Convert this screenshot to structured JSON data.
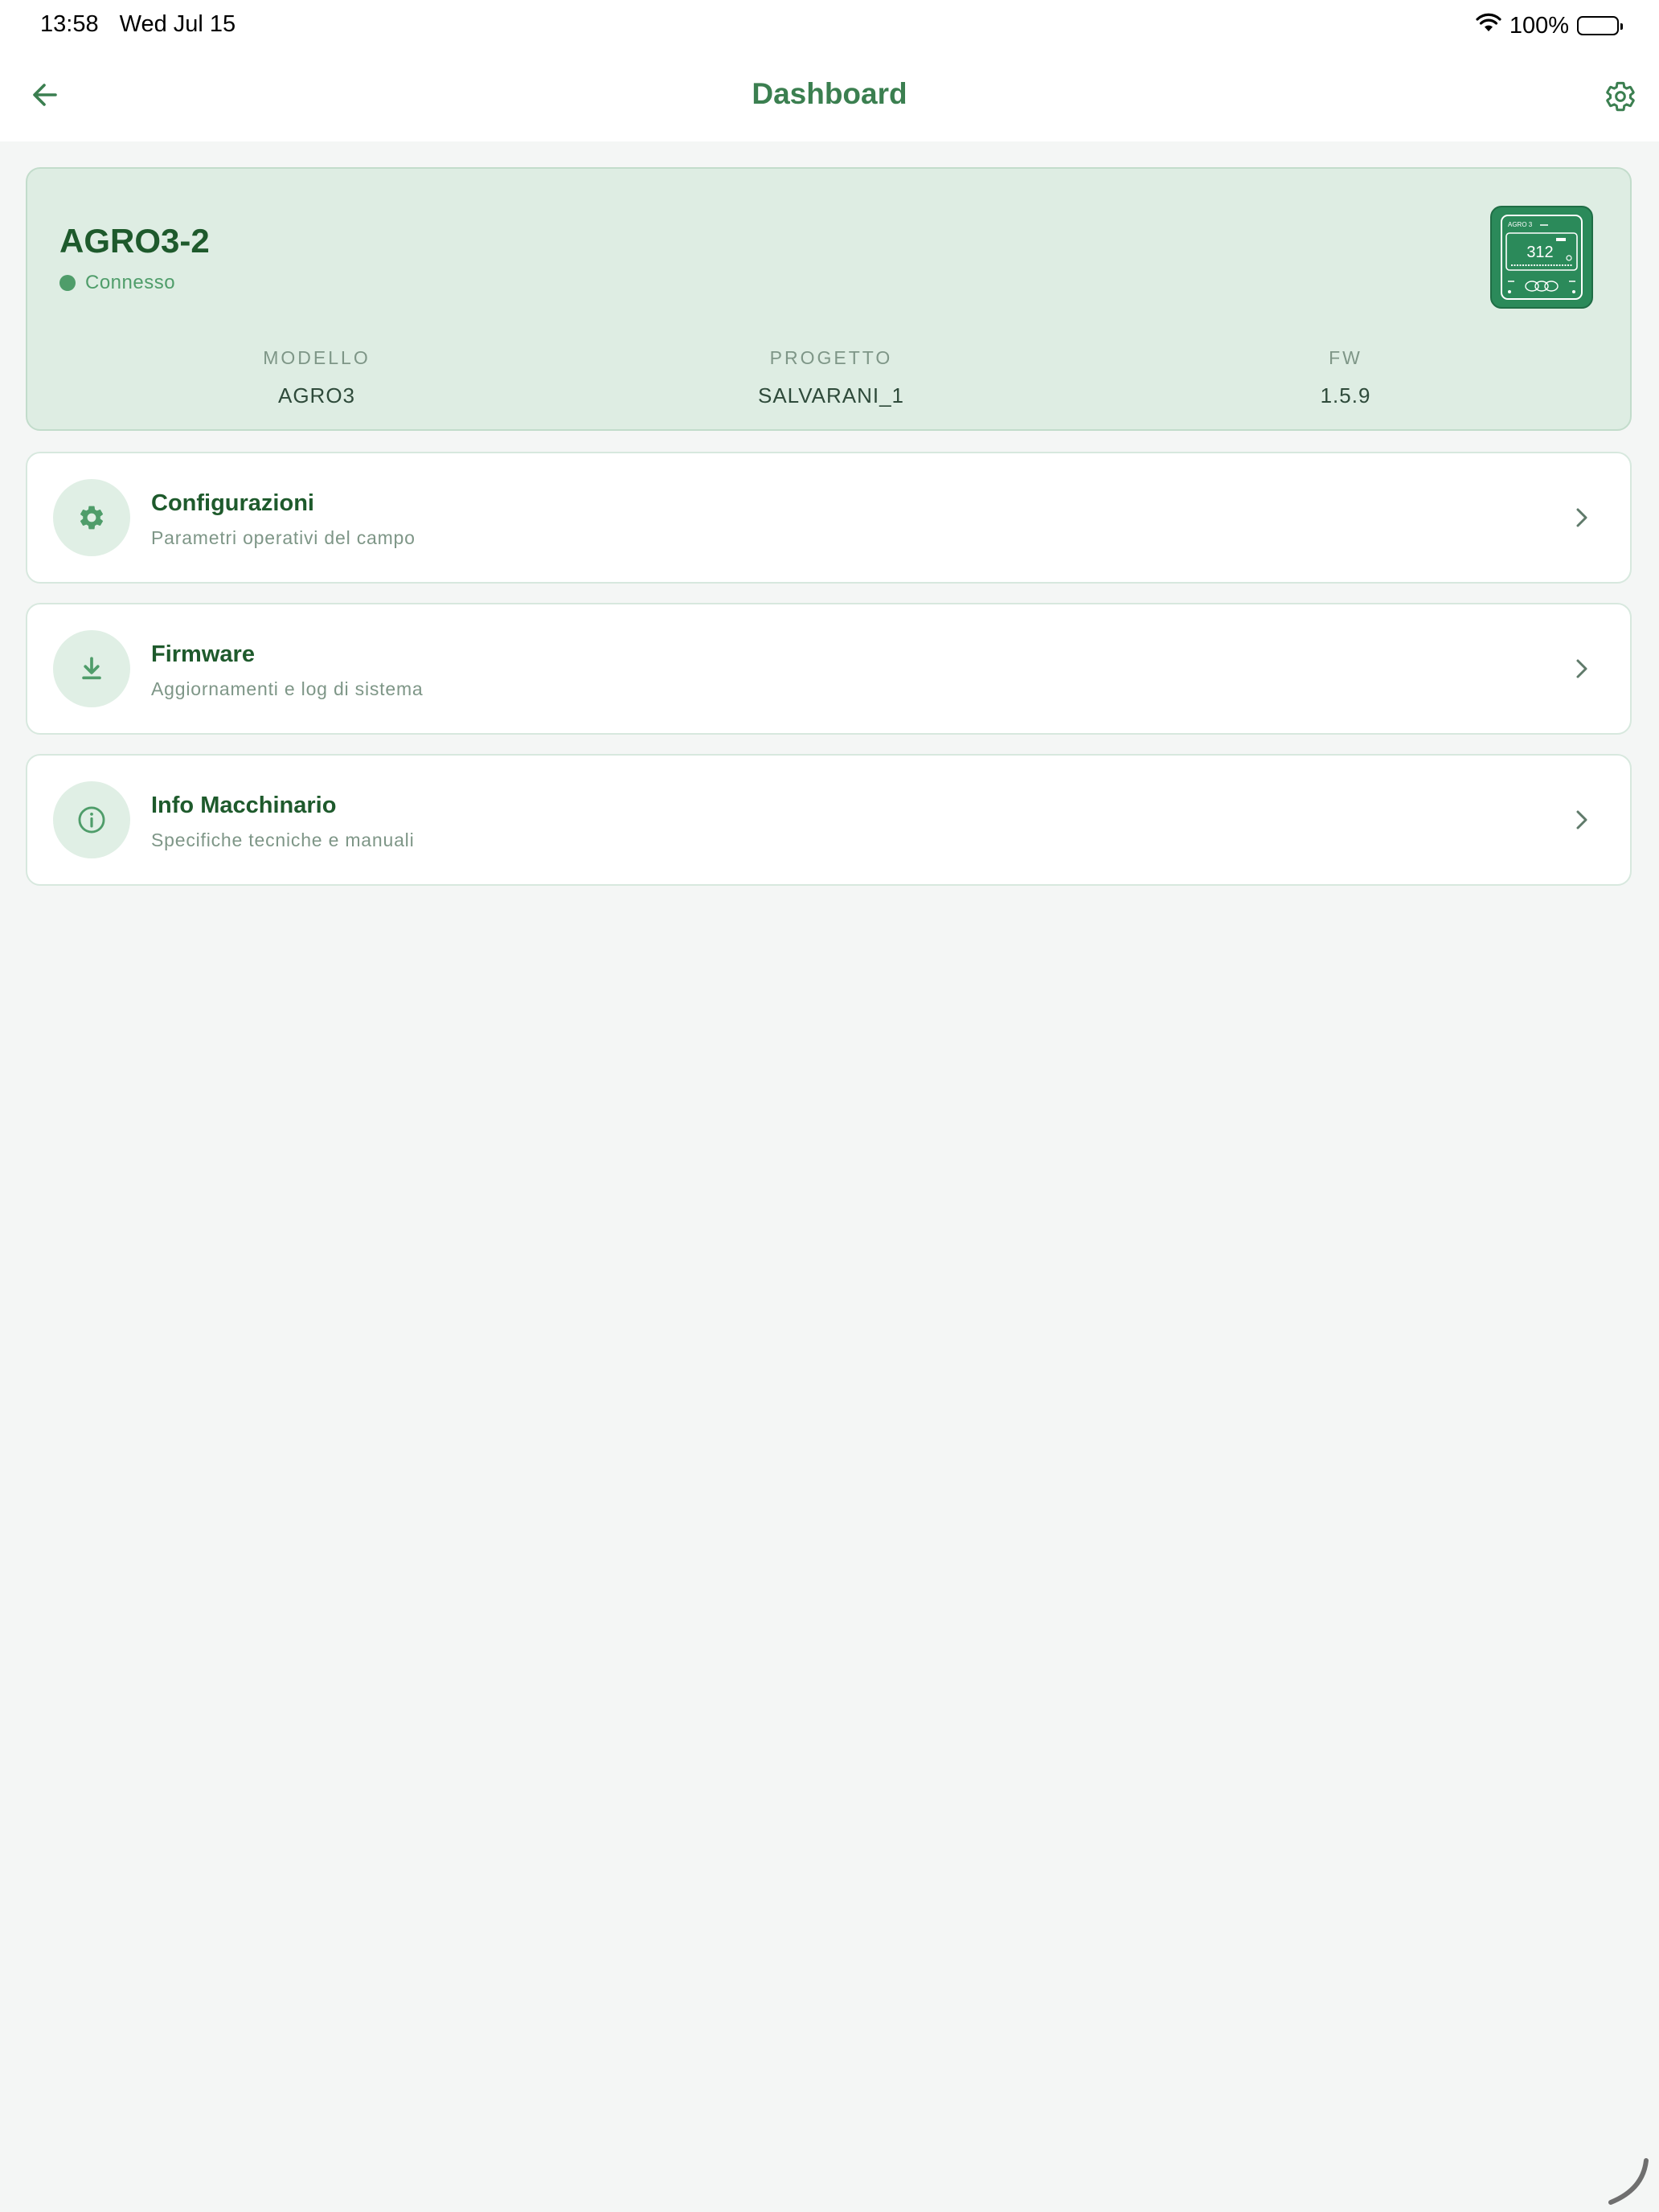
{
  "status_bar": {
    "time": "13:58",
    "date": "Wed Jul 15",
    "battery": "100%",
    "battery_level": 1.0
  },
  "nav": {
    "title": "Dashboard",
    "back_icon": "arrow-left-icon",
    "settings_icon": "gear-icon"
  },
  "device": {
    "name": "AGRO3-2",
    "status": "Connesso",
    "status_color": "#4f9d6a",
    "thumbnail": {
      "brand_text": "AGRO 3",
      "display_value": "312"
    },
    "specs": [
      {
        "label": "MODELLO",
        "value": "AGRO3"
      },
      {
        "label": "PROGETTO",
        "value": "SALVARANI_1"
      },
      {
        "label": "FW",
        "value": "1.5.9"
      }
    ]
  },
  "menu": [
    {
      "title": "Configurazioni",
      "subtitle": "Parametri operativi del campo",
      "icon": "gear-icon"
    },
    {
      "title": "Firmware",
      "subtitle": "Aggiornamenti e log di sistema",
      "icon": "download-icon"
    },
    {
      "title": "Info Macchinario",
      "subtitle": "Specifiche tecniche e manuali",
      "icon": "info-icon"
    }
  ],
  "colors": {
    "accent": "#3b7f50",
    "dark_green": "#1e5a2c",
    "card_bg": "#deede3",
    "page_bg": "#f4f6f5"
  }
}
